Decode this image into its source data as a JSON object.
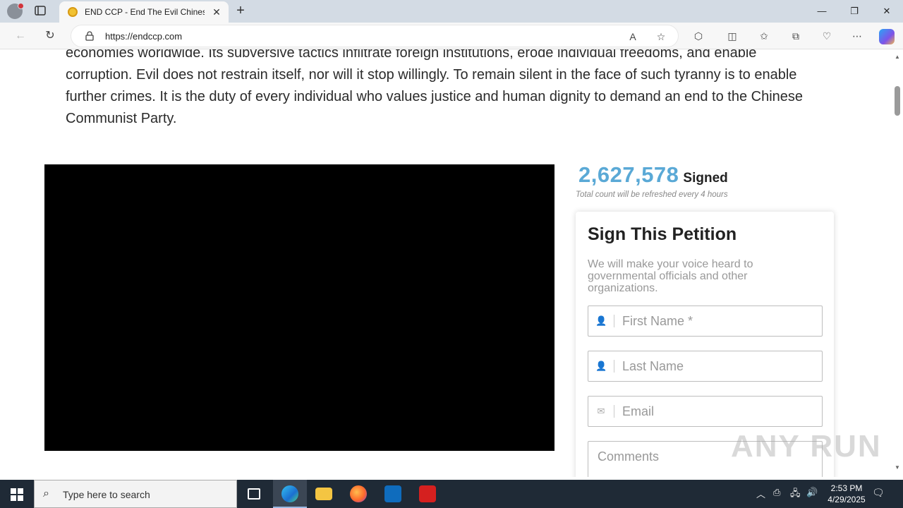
{
  "browser": {
    "tab_title": "END CCP - End The Evil Chinese Communist Party",
    "tab_close": "✕",
    "new_tab": "+",
    "url": "https://endccp.com",
    "window_minimize": "—",
    "window_restore": "❐",
    "window_close": "✕"
  },
  "page": {
    "paragraph": "economies worldwide. Its subversive tactics infiltrate foreign institutions, erode individual freedoms, and enable corruption. Evil does not restrain itself, nor will it stop willingly. To remain silent in the face of such tyranny is to enable further crimes. It is the duty of every individual who values justice and human dignity to demand an end to the Chinese Communist Party.",
    "signed_count": "2,627,578",
    "signed_label": "Signed",
    "refresh_note": "Total count will be refreshed every 4 hours",
    "petition": {
      "title": "Sign This Petition",
      "subtitle": "We will make your voice heard to governmental officials and other organizations.",
      "first_name_placeholder": "First Name *",
      "last_name_placeholder": "Last Name",
      "email_placeholder": "Email",
      "comments_placeholder": "Comments"
    }
  },
  "watermark": "ANY RUN",
  "taskbar": {
    "search_placeholder": "Type here to search",
    "time": "2:53 PM",
    "date": "4/29/2025"
  },
  "colors": {
    "counter_accent": "#5aa9d6",
    "taskbar_bg": "#1f2a36"
  }
}
